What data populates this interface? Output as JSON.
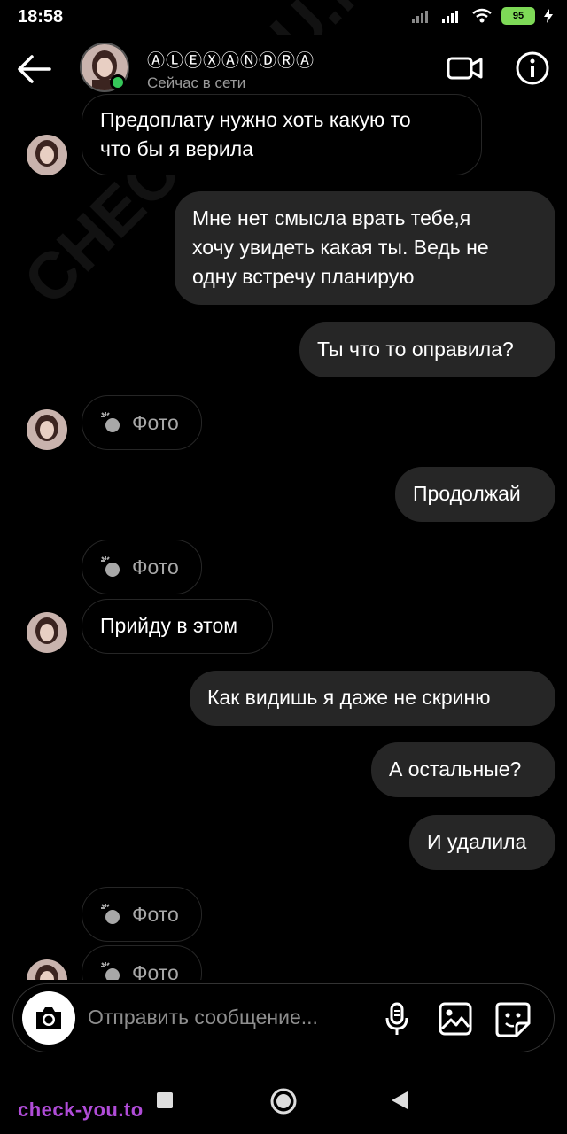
{
  "status_bar": {
    "time": "18:58",
    "battery": "95"
  },
  "header": {
    "name": "ⒶⓁⒺⓍⒶⓃⒹⓇⒶ",
    "status": "Сейчас в сети"
  },
  "messages": [
    {
      "side": "in",
      "text_line1": "Предоплату нужно хоть какую то",
      "text_line2": "что бы я верила"
    },
    {
      "side": "out",
      "text_line1": "Мне нет смысла врать тебе,я",
      "text_line2": "хочу увидеть какая ты. Ведь не",
      "text_line3": "одну встречу планирую"
    },
    {
      "side": "out",
      "text": "Ты что то оправила?"
    },
    {
      "side": "in",
      "type": "photo",
      "label": "Фото"
    },
    {
      "side": "out",
      "text": "Продолжай"
    },
    {
      "side": "in",
      "type": "photo",
      "label": "Фото"
    },
    {
      "side": "in",
      "text": "Прийду в этом"
    },
    {
      "side": "out",
      "text": "Как видишь я даже не скриню"
    },
    {
      "side": "out",
      "text": "А остальные?"
    },
    {
      "side": "out",
      "text": "И удалила"
    },
    {
      "side": "in",
      "type": "photo",
      "label": "Фото"
    },
    {
      "side": "in",
      "type": "photo",
      "label": "Фото"
    }
  ],
  "composer": {
    "placeholder": "Отправить сообщение..."
  },
  "watermark": {
    "text": "check-you.to",
    "diagonal": "CHECK-YOU.ME"
  },
  "colors": {
    "background": "#000000",
    "outgoing_bubble": "#262626",
    "online": "#35c759",
    "watermark": "#b04cd8"
  }
}
